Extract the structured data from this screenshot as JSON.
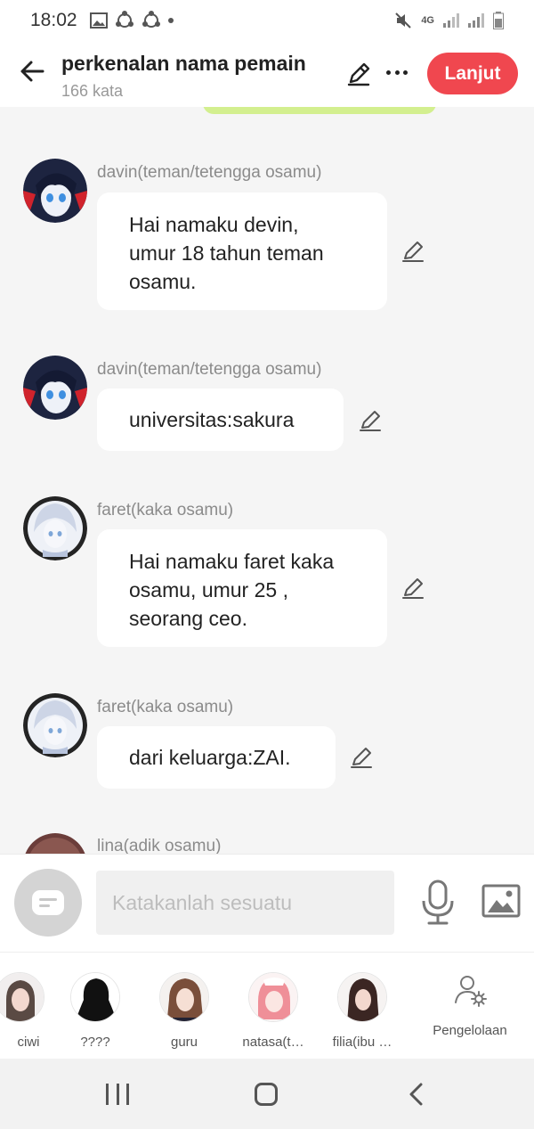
{
  "status": {
    "time": "18:02",
    "network": "4G"
  },
  "header": {
    "title": "perkenalan nama pemain",
    "subtitle": "166 kata",
    "next_label": "Lanjut",
    "accent_color": "#f0474f"
  },
  "messages": [
    {
      "sender": "davin(teman/tetengga osamu)",
      "lines": [
        "Hai namaku devin,",
        "umur 18 tahun teman",
        "osamu."
      ]
    },
    {
      "sender": "davin(teman/tetengga osamu)",
      "lines": [
        "universitas:sakura"
      ]
    },
    {
      "sender": "faret(kaka osamu)",
      "lines": [
        "Hai namaku faret kaka",
        "osamu, umur 25 ,",
        "seorang ceo."
      ]
    },
    {
      "sender": "faret(kaka osamu)",
      "lines": [
        "dari keluarga:ZAI."
      ]
    },
    {
      "sender": "lina(adik osamu)"
    }
  ],
  "input": {
    "placeholder": "Katakanlah sesuatu"
  },
  "characters": [
    {
      "name": "ciwi"
    },
    {
      "name": "????"
    },
    {
      "name": "guru"
    },
    {
      "name": "natasa(t…"
    },
    {
      "name": "filia(ibu …"
    }
  ],
  "manage_label": "Pengelolaan",
  "icons": {
    "back": "arrow-left-icon",
    "edit": "pencil-icon",
    "more": "more-horizontal-icon",
    "mic": "microphone-icon",
    "image": "image-icon",
    "manage": "person-gear-icon"
  }
}
